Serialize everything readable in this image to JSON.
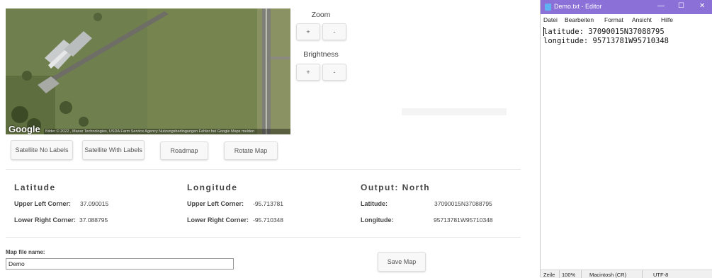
{
  "map": {
    "logo": "Google",
    "attribution": "Bilder © 2022 , Maxar Technologies, USDA Farm Service Agency   Nutzungsbedingungen   Fehler bei Google Maps melden"
  },
  "zoom": {
    "label": "Zoom",
    "plus": "+",
    "minus": "-"
  },
  "brightness": {
    "label": "Brightness",
    "plus": "+",
    "minus": "-"
  },
  "map_buttons": {
    "satellite_no_labels": "Satellite No Labels",
    "satellite_with_labels": "Satellite With Labels",
    "roadmap": "Roadmap",
    "rotate": "Rotate Map"
  },
  "latitude": {
    "title": "Latitude",
    "upper_left_label": "Upper Left Corner:",
    "upper_left_value": "37.090015",
    "lower_right_label": "Lower Right Corner:",
    "lower_right_value": "37.088795"
  },
  "longitude": {
    "title": "Longitude",
    "upper_left_label": "Upper Left Corner:",
    "upper_left_value": "-95.713781",
    "lower_right_label": "Lower Right Corner:",
    "lower_right_value": "-95.710348"
  },
  "output": {
    "title": "Output:  North",
    "latitude_label": "Latitude:",
    "latitude_value": "37090015N37088795",
    "longitude_label": "Longitude:",
    "longitude_value": "95713781W95710348"
  },
  "file": {
    "label": "Map file name:",
    "value": "Demo",
    "save_button": "Save Map"
  },
  "notepad": {
    "title": "Demo.txt - Editor",
    "window_controls": {
      "minimize": "—",
      "maximize": "☐",
      "close": "✕"
    },
    "menu": [
      "Datei",
      "Bearbeiten",
      "Format",
      "Ansicht",
      "Hilfe"
    ],
    "lines": [
      "latitude: 37090015N37088795",
      "longitude: 95713781W95710348"
    ],
    "status": {
      "position": "Zeile",
      "zoom": "100%",
      "line_ending": "Macintosh (CR)",
      "encoding": "UTF-8"
    },
    "colors": {
      "titlebar": "#8b70d8"
    }
  }
}
